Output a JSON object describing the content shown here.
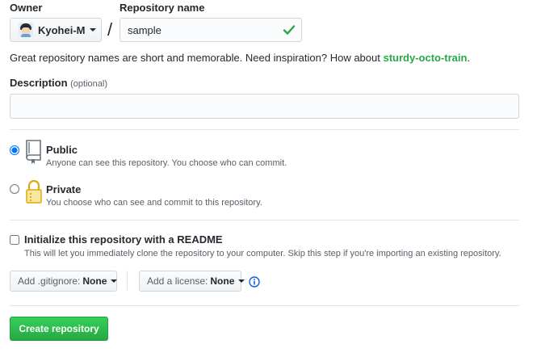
{
  "owner": {
    "label": "Owner",
    "name": "Kyohei-M"
  },
  "repo": {
    "label": "Repository name",
    "value": "sample",
    "separator": "/"
  },
  "hint": {
    "text": "Great repository names are short and memorable. Need inspiration? How about ",
    "suggestion": "sturdy-octo-train",
    "end": "."
  },
  "description": {
    "label": "Description",
    "optional": "(optional)",
    "value": ""
  },
  "visibility": {
    "selected": "public",
    "public": {
      "title": "Public",
      "note": "Anyone can see this repository. You choose who can commit."
    },
    "private": {
      "title": "Private",
      "note": "You choose who can see and commit to this repository."
    }
  },
  "readme": {
    "label": "Initialize this repository with a README",
    "note": "This will let you immediately clone the repository to your computer. Skip this step if you're importing an existing repository.",
    "checked": false
  },
  "gitignore": {
    "prefix": "Add .gitignore:",
    "value": "None"
  },
  "license": {
    "prefix": "Add a license:",
    "value": "None"
  },
  "create_button": "Create repository",
  "colors": {
    "accent_green": "#28a745",
    "info_blue": "#0366d6",
    "text": "#24292e",
    "muted": "#586069"
  },
  "icons": {
    "owner_avatar": "avatar",
    "valid": "check-icon",
    "public": "repo-book-icon",
    "private": "lock-icon",
    "info": "info-icon"
  }
}
